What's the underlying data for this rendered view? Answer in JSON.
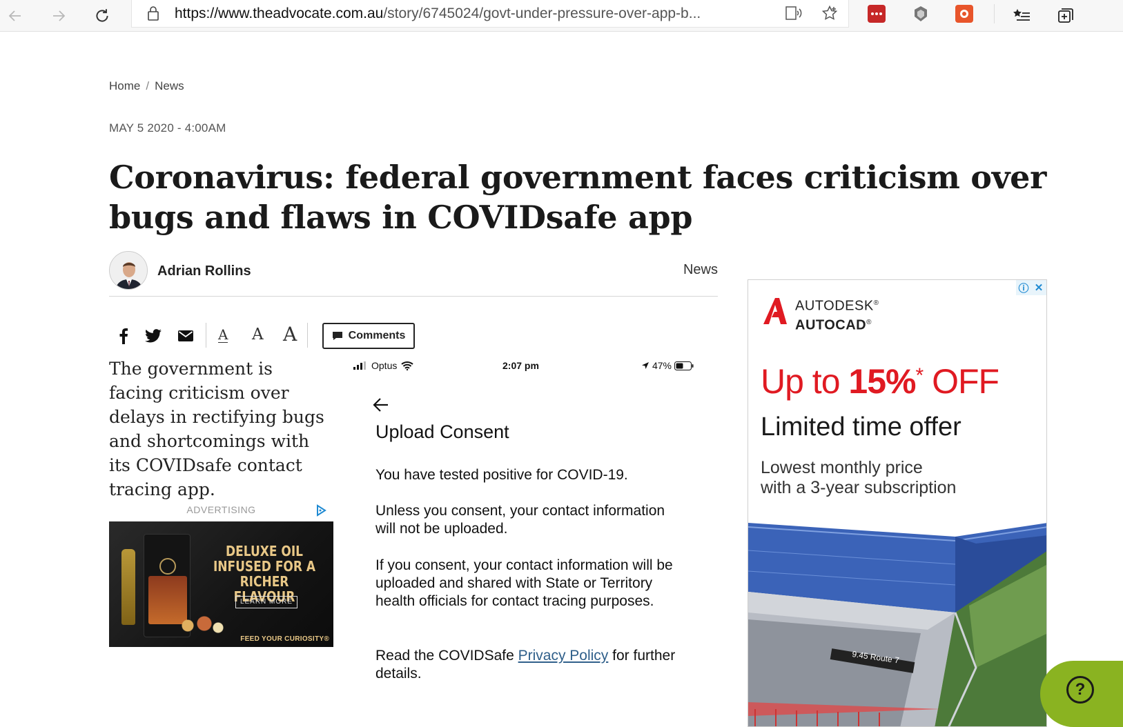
{
  "browser": {
    "url_host": "https://www.theadvocate.com.au",
    "url_path": "/story/6745024/govt-under-pressure-over-app-b...",
    "icons": [
      "back-icon",
      "forward-icon",
      "refresh-icon",
      "lock-icon",
      "read-aloud-icon",
      "favorite-star-icon",
      "extension-lastpass-icon",
      "extension-shield-icon",
      "extension-red-icon",
      "favorites-list-icon",
      "collections-icon"
    ]
  },
  "breadcrumb": {
    "home": "Home",
    "separator": "/",
    "section": "News"
  },
  "article": {
    "dateline": "MAY 5 2020 - 4:00AM",
    "headline": "Coronavirus: federal government faces criticism over bugs and flaws in COVIDsafe app",
    "author": "Adrian Rollins",
    "section_tag": "News",
    "lede": "The government is facing criticism over delays in rectifying bugs and shortcomings with its COVIDsafe contact tracing app."
  },
  "share": {
    "font_small": "A",
    "font_medium": "A",
    "font_large": "A",
    "comments_label": "Comments"
  },
  "inline_ad": {
    "label": "ADVERTISING",
    "headline": "DELUXE OIL INFUSED FOR A RICHER FLAVOUR",
    "cta": "LEARN MORE",
    "tagline": "FEED YOUR CURIOSITY®"
  },
  "phone": {
    "carrier": "Optus",
    "time": "2:07 pm",
    "battery": "47%",
    "title": "Upload Consent",
    "p1": "You have tested positive for COVID-19.",
    "p2": "Unless you consent, your contact information will not be uploaded.",
    "p3": "If you consent, your contact information will be uploaded and shared with State or Territory health officials for contact tracing purposes.",
    "p4_prefix": "Read the COVIDSafe ",
    "p4_link": "Privacy Policy",
    "p4_suffix": "  for further details."
  },
  "right_ad": {
    "brand_line1": "AUTODESK",
    "brand_line1_mark": "®",
    "brand_line2": "AUTOCAD",
    "brand_line2_mark": "®",
    "offer_prefix": "Up to ",
    "offer_pct": "15%",
    "offer_mark": "*",
    "offer_suffix": " OFF",
    "limited": "Limited time offer",
    "lowest_line1": "Lowest monthly price",
    "lowest_line2": "with a 3-year subscription",
    "render_sign": "9.45 Route 7",
    "accent_color": "#e01a22"
  },
  "help": {
    "symbol": "?"
  }
}
